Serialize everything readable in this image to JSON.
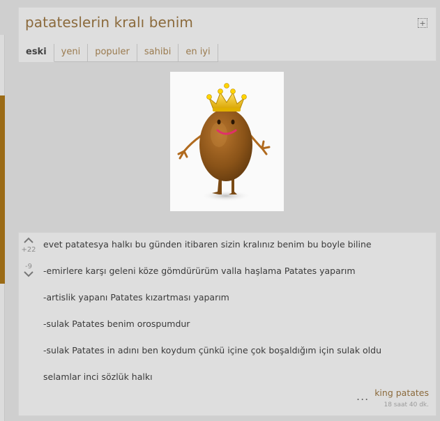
{
  "topic": {
    "title": "patateslerin kralı benim",
    "expand_icon": "expand-plus-icon"
  },
  "tabs": [
    {
      "label": "eski",
      "active": true
    },
    {
      "label": "yeni",
      "active": false
    },
    {
      "label": "populer",
      "active": false
    },
    {
      "label": "sahibi",
      "active": false
    },
    {
      "label": "en iyi",
      "active": false
    }
  ],
  "image": {
    "subject": "crowned cartoon potato"
  },
  "entry": {
    "upvotes": "+22",
    "downvotes": "-9",
    "lines": [
      "evet patatesya halkı bu günden itibaren sizin kralınız benim bu boyle biline",
      "-emirlere karşı geleni köze gömdürürüm valla haşlama Patates yaparım",
      "-artislik yapanı Patates kızartması yaparım",
      "-sulak Patates benim orospumdur",
      "-sulak Patates in adını ben koydum çünkü içine çok boşaldığım için sulak oldu",
      "selamlar inci sözlük halkı"
    ],
    "more": "...",
    "author": "king patates",
    "time": "18 saat 40 dk."
  },
  "colors": {
    "background": "#cfcfcf",
    "card": "#dedede",
    "accent": "#8b6a3c",
    "sidebar_accent": "#9b6b16"
  }
}
